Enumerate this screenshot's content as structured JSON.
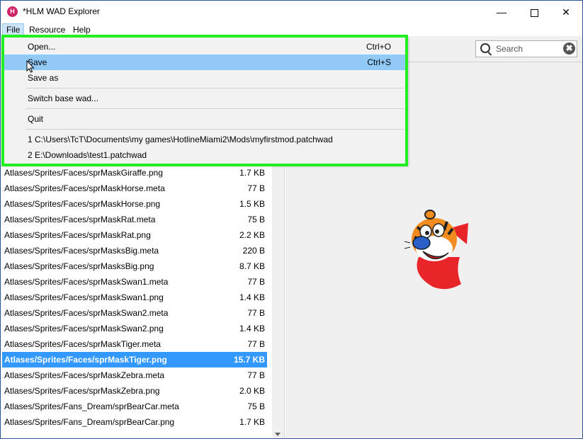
{
  "window": {
    "title": "*HLM WAD Explorer",
    "icon": "app-logo-icon",
    "controls": {
      "minimize": "—",
      "maximize": "",
      "close": "✕"
    }
  },
  "menubar": {
    "file": "File",
    "resource": "Resource",
    "help": "Help"
  },
  "search": {
    "placeholder": "Search",
    "clear": "✖"
  },
  "file_menu": {
    "items": [
      {
        "label": "Open...",
        "shortcut": "Ctrl+O"
      },
      {
        "label": "Save",
        "shortcut": "Ctrl+S"
      },
      {
        "label": "Save as",
        "shortcut": ""
      },
      {
        "label": "Switch base wad...",
        "shortcut": ""
      },
      {
        "label": "Quit",
        "shortcut": ""
      },
      {
        "label": "1 C:\\Users\\TcT\\Documents\\my games\\HotlineMiami2\\Mods\\myfirstmod.patchwad",
        "shortcut": ""
      },
      {
        "label": "2 E:\\Downloads\\test1.patchwad",
        "shortcut": ""
      }
    ]
  },
  "files": [
    {
      "name": "Atlases/Sprites/Faces/sprMaskGiraffe.png",
      "size": "1.7 KB"
    },
    {
      "name": "Atlases/Sprites/Faces/sprMaskHorse.meta",
      "size": "77 B"
    },
    {
      "name": "Atlases/Sprites/Faces/sprMaskHorse.png",
      "size": "1.5 KB"
    },
    {
      "name": "Atlases/Sprites/Faces/sprMaskRat.meta",
      "size": "75 B"
    },
    {
      "name": "Atlases/Sprites/Faces/sprMaskRat.png",
      "size": "2.2 KB"
    },
    {
      "name": "Atlases/Sprites/Faces/sprMasksBig.meta",
      "size": "220 B"
    },
    {
      "name": "Atlases/Sprites/Faces/sprMasksBig.png",
      "size": "8.7 KB"
    },
    {
      "name": "Atlases/Sprites/Faces/sprMaskSwan1.meta",
      "size": "77 B"
    },
    {
      "name": "Atlases/Sprites/Faces/sprMaskSwan1.png",
      "size": "1.4 KB"
    },
    {
      "name": "Atlases/Sprites/Faces/sprMaskSwan2.meta",
      "size": "77 B"
    },
    {
      "name": "Atlases/Sprites/Faces/sprMaskSwan2.png",
      "size": "1.4 KB"
    },
    {
      "name": "Atlases/Sprites/Faces/sprMaskTiger.meta",
      "size": "77 B"
    },
    {
      "name": "Atlases/Sprites/Faces/sprMaskTiger.png",
      "size": "15.7 KB"
    },
    {
      "name": "Atlases/Sprites/Faces/sprMaskZebra.meta",
      "size": "77 B"
    },
    {
      "name": "Atlases/Sprites/Faces/sprMaskZebra.png",
      "size": "2.0 KB"
    },
    {
      "name": "Atlases/Sprites/Fans_Dream/sprBearCar.meta",
      "size": "75 B"
    },
    {
      "name": "Atlases/Sprites/Fans_Dream/sprBearCar.png",
      "size": "1.7 KB"
    }
  ],
  "selected_file": "Atlases/Sprites/Faces/sprMaskTiger.png",
  "preview": {
    "image": "tiger-mask-sprite"
  },
  "colors": {
    "selection": "#3399ff",
    "menu_hover": "#91c9f7",
    "highlight_border": "#22ee22"
  }
}
